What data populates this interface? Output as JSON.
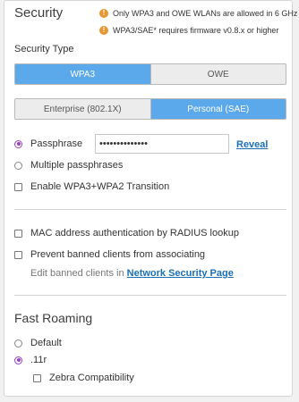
{
  "security": {
    "title": "Security",
    "warnings": [
      "Only WPA3 and OWE WLANs are allowed in 6 GHz",
      "WPA3/SAE* requires firmware v0.8.x or higher"
    ],
    "warning_icon": "exclamation-icon",
    "type_label": "Security Type",
    "type_options": [
      "WPA3",
      "OWE"
    ],
    "type_selected": "WPA3",
    "mode_options": [
      "Enterprise (802.1X)",
      "Personal (SAE)"
    ],
    "mode_selected": "Personal (SAE)",
    "passphrase_label": "Passphrase",
    "passphrase_value": "••••••••••••••",
    "reveal_link": "Reveal",
    "multiple_passphrases_label": "Multiple passphrases",
    "transition_label": "Enable WPA3+WPA2 Transition",
    "mac_auth_label": "MAC address authentication by RADIUS lookup",
    "prevent_banned_label": "Prevent banned clients from associating",
    "edit_banned_prefix": "Edit banned clients in ",
    "edit_banned_link": "Network Security Page"
  },
  "fast_roaming": {
    "title": "Fast Roaming",
    "options": [
      "Default",
      ".11r"
    ],
    "selected": ".11r",
    "zebra_label": "Zebra Compatibility"
  },
  "colors": {
    "accent": "#5ba8ea",
    "radio_selected": "#9b3fbf",
    "warning": "#e8962f",
    "link": "#1a6fb8"
  }
}
